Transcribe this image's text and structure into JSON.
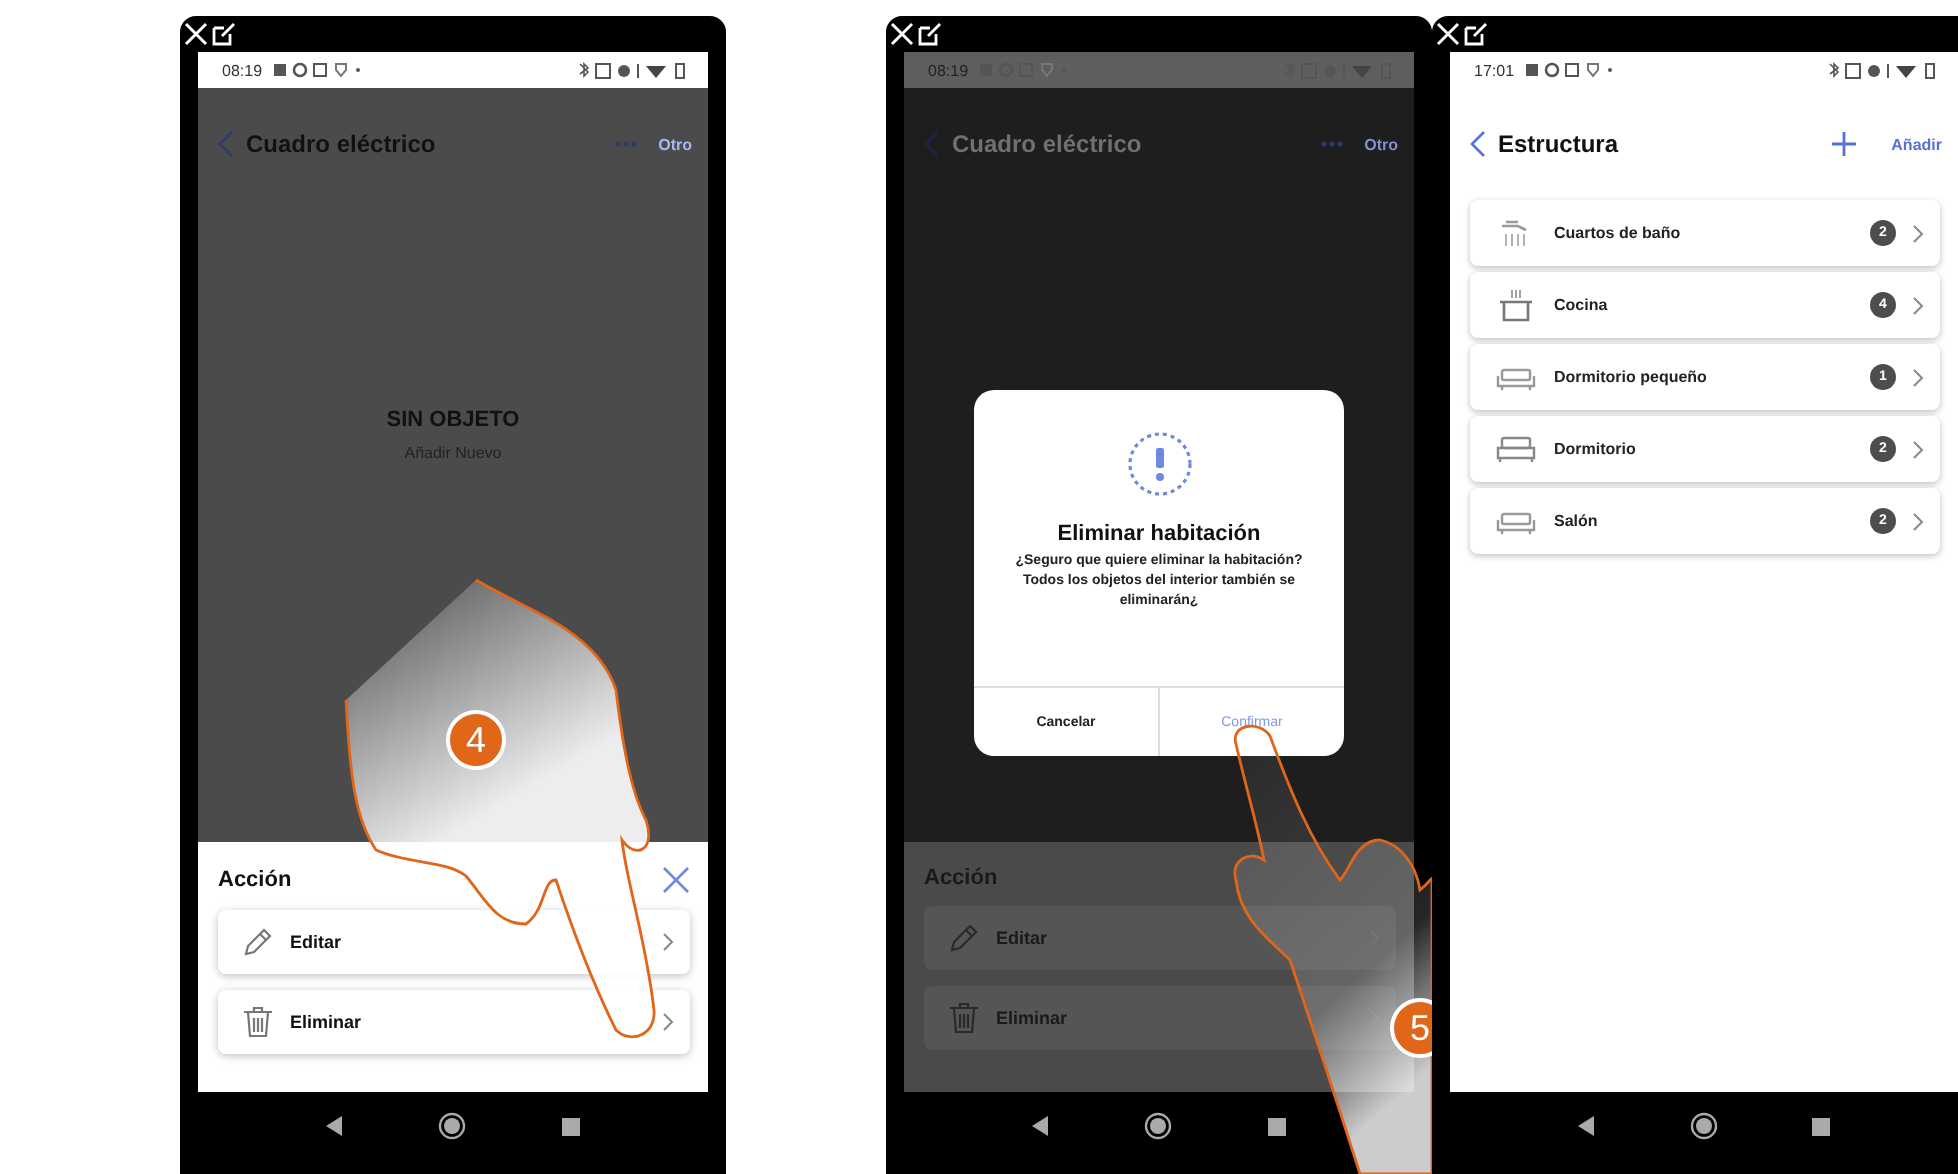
{
  "phones": [
    {
      "kind": "sheet",
      "status_time": "08:19",
      "header": {
        "title": "Cuadro eléctrico",
        "action_label": "Otro"
      },
      "empty": {
        "title": "SIN OBJETO",
        "link": "Añadir Nuevo"
      },
      "sheet": {
        "title": "Acción",
        "dimmed": false,
        "items": [
          {
            "kind": "edit",
            "label": "Editar"
          },
          {
            "kind": "delete",
            "label": "Eliminar"
          }
        ]
      },
      "step": "4"
    },
    {
      "kind": "dialog",
      "status_time": "08:19",
      "header": {
        "title": "Cuadro eléctrico",
        "action_label": "Otro"
      },
      "dialog": {
        "title": "Eliminar habitación",
        "message": "¿Seguro que quiere eliminar la habitación? Todos los objetos del interior también se eliminarán¿",
        "buttons": [
          {
            "label": "Cancelar",
            "primary": false
          },
          {
            "label": "Confirmar",
            "primary": true
          }
        ]
      },
      "sheet": {
        "title": "Acción",
        "dimmed": true,
        "items": [
          {
            "kind": "edit",
            "label": "Editar"
          },
          {
            "kind": "delete",
            "label": "Eliminar"
          }
        ]
      },
      "step": "5"
    },
    {
      "kind": "list",
      "status_time": "17:01",
      "header": {
        "title": "Estructura",
        "action_label": "Añadir"
      },
      "rooms": [
        {
          "kind": "bath",
          "name": "Cuartos de baño",
          "count": "2"
        },
        {
          "kind": "kitchen",
          "name": "Cocina",
          "count": "4"
        },
        {
          "kind": "sofa",
          "name": "Dormitorio pequeño",
          "count": "1"
        },
        {
          "kind": "bed",
          "name": "Dormitorio",
          "count": "2"
        },
        {
          "kind": "sofa",
          "name": "Salón",
          "count": "2"
        }
      ]
    }
  ]
}
